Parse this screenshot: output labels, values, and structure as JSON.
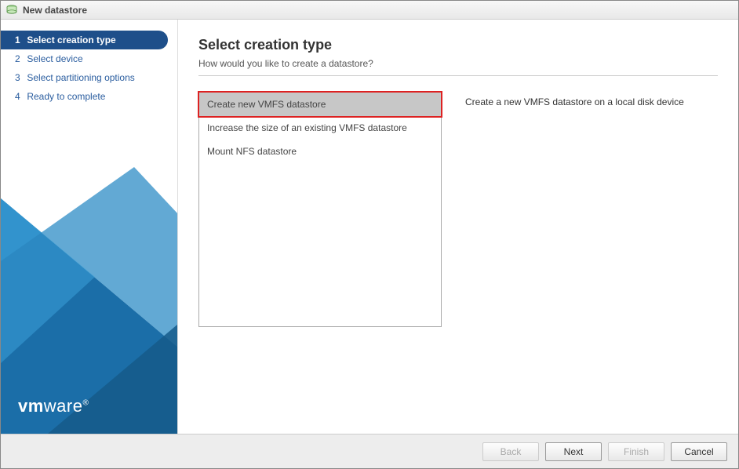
{
  "window": {
    "title": "New datastore"
  },
  "sidebar": {
    "steps": [
      {
        "num": "1",
        "label": "Select creation type"
      },
      {
        "num": "2",
        "label": "Select device"
      },
      {
        "num": "3",
        "label": "Select partitioning options"
      },
      {
        "num": "4",
        "label": "Ready to complete"
      }
    ]
  },
  "logo": {
    "prefix": "vm",
    "suffix": "ware",
    "mark": "®"
  },
  "main": {
    "title": "Select creation type",
    "subtitle": "How would you like to create a datastore?",
    "options": [
      "Create new VMFS datastore",
      "Increase the size of an existing VMFS datastore",
      "Mount NFS datastore"
    ],
    "description": "Create a new VMFS datastore on a local disk device"
  },
  "footer": {
    "back": "Back",
    "next": "Next",
    "finish": "Finish",
    "cancel": "Cancel"
  }
}
